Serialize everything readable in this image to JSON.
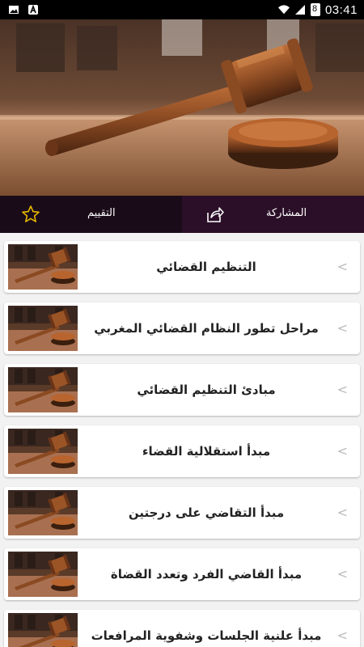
{
  "status_bar": {
    "time": "03:41",
    "battery_level": "8"
  },
  "action_bar": {
    "share_label": "المشاركة",
    "rate_label": "التقييم"
  },
  "list": {
    "chevron": "<",
    "items": [
      {
        "title": "التنظيم القضائي"
      },
      {
        "title": "مراحل تطور النظام القضائي المغربي"
      },
      {
        "title": "مبادئ التنظيم القضائي"
      },
      {
        "title": "مبدأ استقلالية القضاء"
      },
      {
        "title": "مبدأ التقاضي على درجتين"
      },
      {
        "title": "مبدأ القاضي الفرد وتعدد القضاة"
      },
      {
        "title": "مبدأ علنية الجلسات وشفوية المرافعات"
      }
    ]
  },
  "colors": {
    "action_rate_bg": "#1a0b18",
    "action_share_bg": "#2b0f28",
    "page_bg": "#f2f2f2"
  }
}
